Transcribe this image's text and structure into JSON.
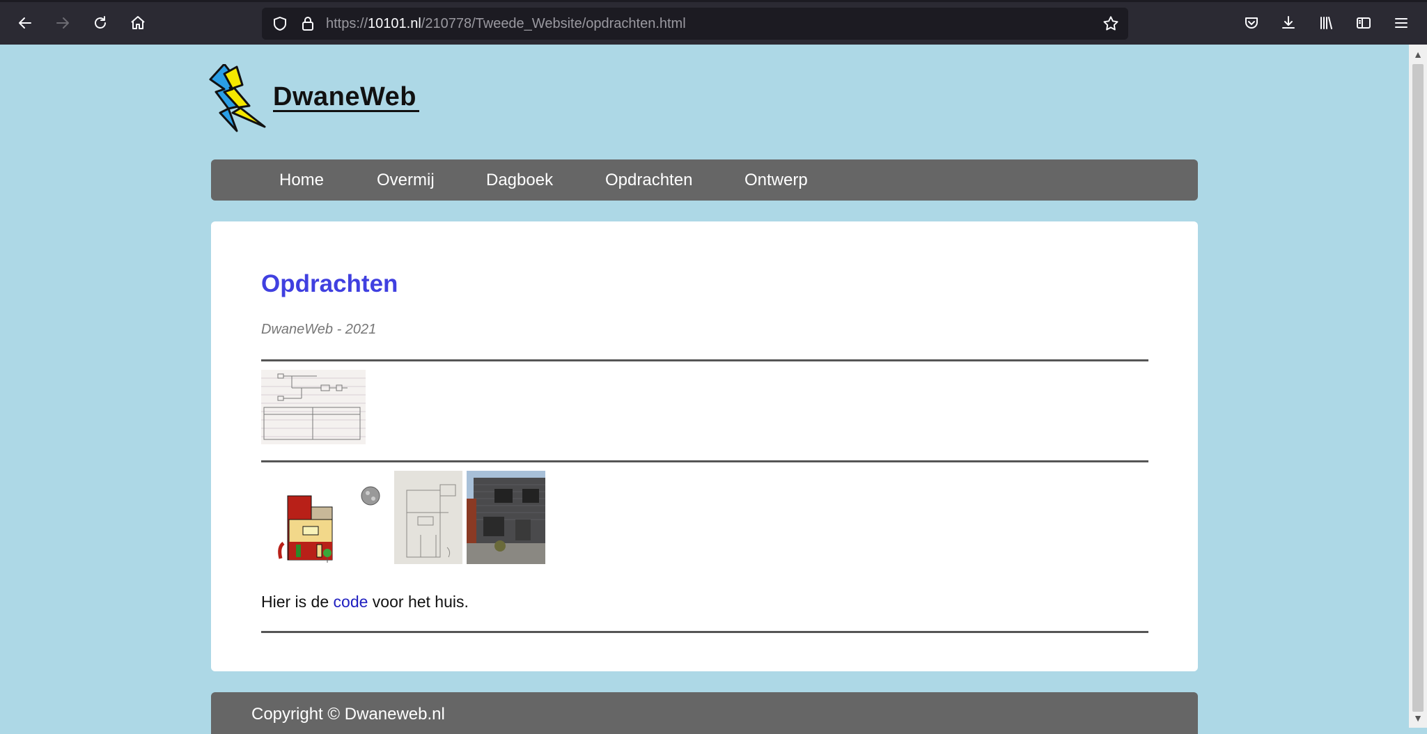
{
  "browser": {
    "url_prefix": "https://",
    "url_host": "10101.nl",
    "url_path": "/210778/Tweede_Website/opdrachten.html"
  },
  "site": {
    "logo_text": "DwaneWeb",
    "nav": [
      "Home",
      "Overmij",
      "Dagboek",
      "Opdrachten",
      "Ontwerp"
    ]
  },
  "page": {
    "title": "Opdrachten",
    "subtitle": "DwaneWeb - 2021",
    "para_before": "Hier is de ",
    "para_link": "code",
    "para_after": " voor het huis."
  },
  "footer": {
    "copyright": "Copyright © Dwaneweb.nl"
  },
  "colors": {
    "page_background": "#add8e6",
    "nav_background": "#666666",
    "title_color": "#4040e0",
    "link_color": "#2020c0"
  }
}
